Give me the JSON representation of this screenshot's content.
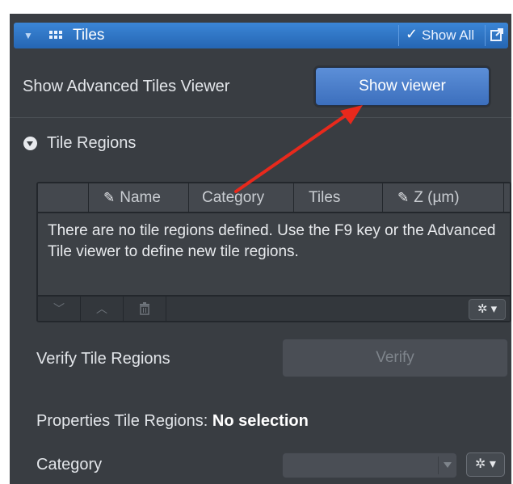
{
  "header": {
    "title": "Tiles",
    "show_all_label": "Show All",
    "check_glyph": "✓",
    "collapse_glyph": "▼"
  },
  "advanced": {
    "label": "Show Advanced Tiles Viewer",
    "button_label": "Show viewer"
  },
  "tile_regions": {
    "section_label": "Tile Regions",
    "columns": [
      "Name",
      "Category",
      "Tiles",
      "Z (µm)"
    ],
    "empty_message": "There are no tile regions defined. Use the F9 key or the Advanced Tile viewer to define new tile regions.",
    "footer_icons": [
      "chevron-down-icon",
      "chevron-up-icon",
      "trash-icon",
      "gear-icon"
    ]
  },
  "verify": {
    "label": "Verify Tile Regions",
    "button_label": "Verify"
  },
  "properties": {
    "prefix": "Properties Tile Regions: ",
    "selection": "No selection"
  },
  "category": {
    "label": "Category",
    "value": ""
  },
  "colors": {
    "header_blue": "#2f74c4",
    "panel_bg": "#393d42",
    "annotation_arrow": "#e8291c"
  }
}
